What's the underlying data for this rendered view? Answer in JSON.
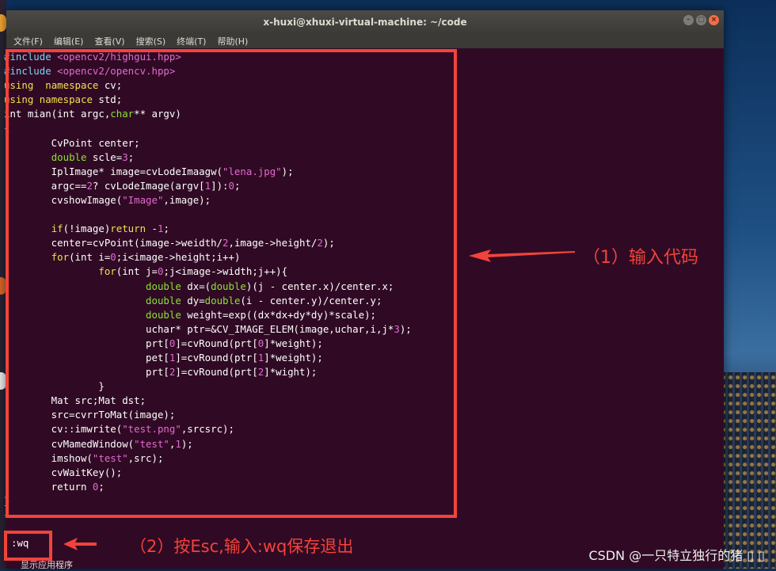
{
  "window": {
    "title": "x-huxi@xhuxi-virtual-machine: ~/code",
    "buttons": [
      "–",
      "▢",
      "×"
    ]
  },
  "menu": [
    "文件(F)",
    "编辑(E)",
    "查看(V)",
    "搜索(S)",
    "终端(T)",
    "帮助(H)"
  ],
  "code_lines": [
    [
      [
        "pp",
        "#include "
      ],
      [
        "str",
        "<opencv2/highgui.hpp>"
      ]
    ],
    [
      [
        "pp",
        "#include "
      ],
      [
        "str",
        "<opencv2/opencv.hpp>"
      ]
    ],
    [
      [
        "kw",
        "using"
      ],
      [
        "",
        "  "
      ],
      [
        "kw",
        "namespace"
      ],
      [
        "",
        " cv;"
      ]
    ],
    [
      [
        "kw",
        "using"
      ],
      [
        "",
        " "
      ],
      [
        "kw",
        "namespace"
      ],
      [
        "",
        " std;"
      ]
    ],
    [
      [
        "",
        "int mian(int argc,"
      ],
      [
        "type",
        "char"
      ],
      [
        "",
        "** argv)"
      ]
    ],
    [
      [
        "",
        "{"
      ]
    ],
    [
      [
        "",
        "        CvPoint center;"
      ]
    ],
    [
      [
        "",
        "        "
      ],
      [
        "type",
        "double"
      ],
      [
        "",
        " scle="
      ],
      [
        "num",
        "3"
      ],
      [
        "",
        ";"
      ]
    ],
    [
      [
        "",
        "        IplImage* image=cvLodeImaagw("
      ],
      [
        "str",
        "\"lena.jpg\""
      ],
      [
        "",
        ");"
      ]
    ],
    [
      [
        "",
        "        argc=="
      ],
      [
        "num",
        "2"
      ],
      [
        "",
        "? cvLodeImage(argv["
      ],
      [
        "num",
        "1"
      ],
      [
        "",
        "]):"
      ],
      [
        "num",
        "0"
      ],
      [
        "",
        ";"
      ]
    ],
    [
      [
        "",
        "        cvshowImage("
      ],
      [
        "str",
        "\"Image\""
      ],
      [
        "",
        ",image);"
      ]
    ],
    [
      [
        "",
        ""
      ]
    ],
    [
      [
        "",
        "        "
      ],
      [
        "kw",
        "if"
      ],
      [
        "",
        "(!image)"
      ],
      [
        "kw",
        "return"
      ],
      [
        "",
        " -"
      ],
      [
        "num",
        "1"
      ],
      [
        "",
        ";"
      ]
    ],
    [
      [
        "",
        "        center=cvPoint(image->weidth/"
      ],
      [
        "num",
        "2"
      ],
      [
        "",
        ",image->height/"
      ],
      [
        "num",
        "2"
      ],
      [
        "",
        ");"
      ]
    ],
    [
      [
        "",
        "        "
      ],
      [
        "kw",
        "for"
      ],
      [
        "",
        "(int i="
      ],
      [
        "num",
        "0"
      ],
      [
        "",
        ";i<image->height;i++)"
      ]
    ],
    [
      [
        "",
        "                "
      ],
      [
        "kw",
        "for"
      ],
      [
        "",
        "(int j="
      ],
      [
        "num",
        "0"
      ],
      [
        "",
        ";j<image->width;j++){"
      ]
    ],
    [
      [
        "",
        "                        "
      ],
      [
        "type",
        "double"
      ],
      [
        "",
        " dx=("
      ],
      [
        "type",
        "double"
      ],
      [
        "",
        ")(j - center.x)/center.x;"
      ]
    ],
    [
      [
        "",
        "                        "
      ],
      [
        "type",
        "double"
      ],
      [
        "",
        " dy="
      ],
      [
        "type",
        "double"
      ],
      [
        "",
        "(i - center.y)/center.y;"
      ]
    ],
    [
      [
        "",
        "                        "
      ],
      [
        "type",
        "double"
      ],
      [
        "",
        " weight=exp((dx*dx+dy*dy)*scale);"
      ]
    ],
    [
      [
        "",
        "                        uchar* ptr=&CV_IMAGE_ELEM(image,uchar,i,j*"
      ],
      [
        "num",
        "3"
      ],
      [
        "",
        ");"
      ]
    ],
    [
      [
        "",
        "                        prt["
      ],
      [
        "num",
        "0"
      ],
      [
        "",
        "]=cvRound(prt["
      ],
      [
        "num",
        "0"
      ],
      [
        "",
        "]*weight);"
      ]
    ],
    [
      [
        "",
        "                        pet["
      ],
      [
        "num",
        "1"
      ],
      [
        "",
        "]=cvRound(ptr["
      ],
      [
        "num",
        "1"
      ],
      [
        "",
        "]*weight);"
      ]
    ],
    [
      [
        "",
        "                        prt["
      ],
      [
        "num",
        "2"
      ],
      [
        "",
        "]=cvRound(prt["
      ],
      [
        "num",
        "2"
      ],
      [
        "",
        "]*wight);"
      ]
    ],
    [
      [
        "",
        "                }"
      ]
    ],
    [
      [
        "",
        "        Mat src;Mat dst;"
      ]
    ],
    [
      [
        "",
        "        src=cvrrToMat(image);"
      ]
    ],
    [
      [
        "",
        "        cv::imwrite("
      ],
      [
        "str",
        "\"test.png\""
      ],
      [
        "",
        ",srcsrc);"
      ]
    ],
    [
      [
        "",
        "        cvMamedWindow("
      ],
      [
        "str",
        "\"test\""
      ],
      [
        "",
        ","
      ],
      [
        "num",
        "1"
      ],
      [
        "",
        ");"
      ]
    ],
    [
      [
        "",
        "        imshow("
      ],
      [
        "str",
        "\"test\""
      ],
      [
        "",
        ",src);"
      ]
    ],
    [
      [
        "",
        "        cvWaitKey();"
      ]
    ],
    [
      [
        "",
        "        return "
      ],
      [
        "num",
        "0"
      ],
      [
        "",
        ";"
      ]
    ],
    [
      [
        "",
        "}"
      ]
    ],
    [
      [
        "tilde",
        "~"
      ]
    ]
  ],
  "command_line": ":wq",
  "status_text": "显示应用程序",
  "annotations": {
    "step1": "（1）输入代码",
    "step2": "（2）按Esc,输入:wq保存退出"
  },
  "colors": {
    "annotation": "#f2433a",
    "terminal_bg": "#300a24"
  },
  "watermark": "CSDN @一只特立独行的猪 ▯ ▯"
}
